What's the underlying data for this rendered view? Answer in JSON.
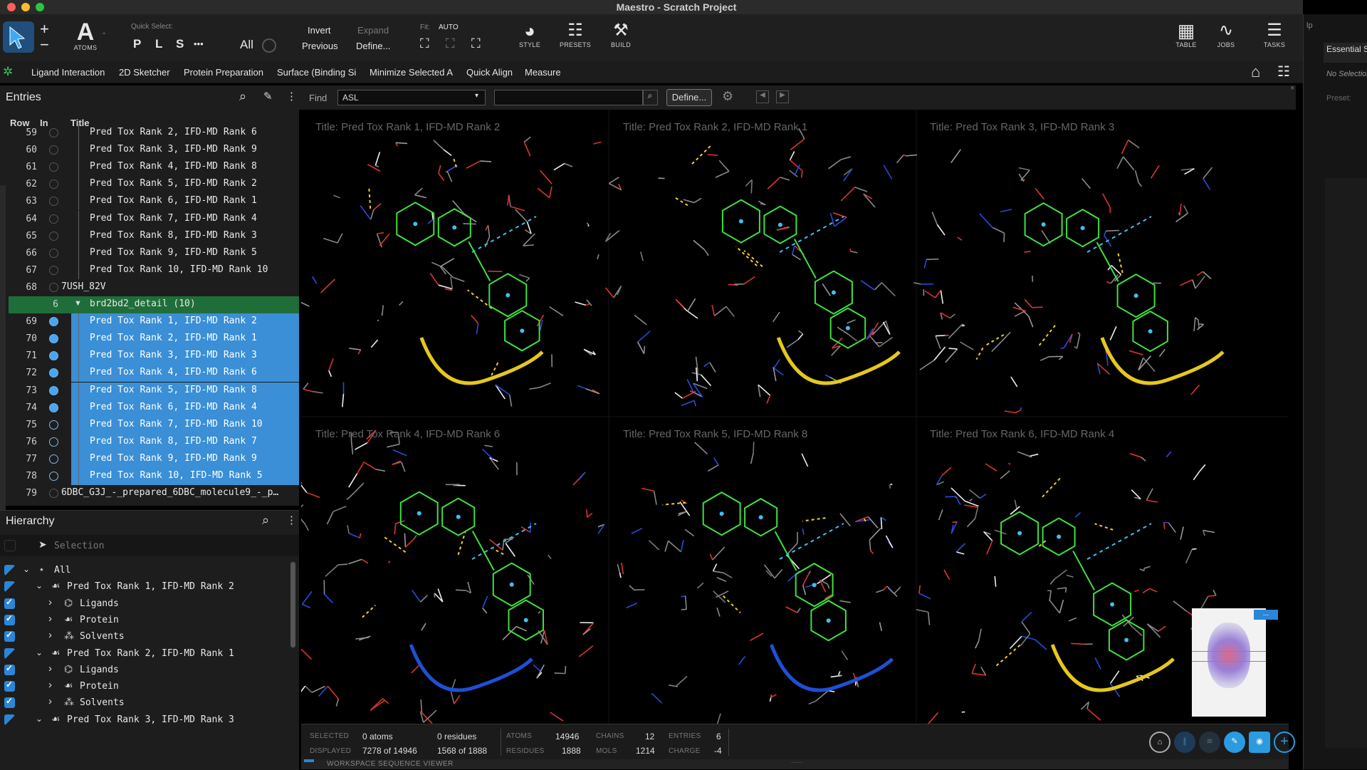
{
  "window": {
    "title": "Maestro - Scratch Project"
  },
  "toolbar": {
    "atoms_label": "ATOMS",
    "quick_select_label": "Quick Select:",
    "qs_p": "P",
    "qs_l": "L",
    "qs_s": "S",
    "qs_more": "•••",
    "qs_all": "All",
    "invert_label": "Invert",
    "previous_label": "Previous",
    "expand_label": "Expand",
    "define_label": "Define...",
    "fit_label": "Fit:",
    "fit_value": "AUTO",
    "style_label": "STYLE",
    "presets_label": "PRESETS",
    "build_label": "BUILD",
    "table_label": "TABLE",
    "jobs_label": "JOBS",
    "tasks_label": "TASKS"
  },
  "menu": [
    "Ligand Interaction",
    "2D Sketcher",
    "Protein Preparation",
    "Surface (Binding Si",
    "Minimize Selected A",
    "Quick Align",
    "Measure"
  ],
  "right_panel": {
    "title": "Essential S",
    "no_selection": "No Selection",
    "preset": "Preset:",
    "help_fragment": "lp"
  },
  "entries": {
    "title": "Entries",
    "col_row": "Row",
    "col_in": "In",
    "col_title": "Title",
    "rows": [
      {
        "num": "59",
        "title": "Pred Tox Rank 2, IFD-MD Rank 6",
        "sel": false
      },
      {
        "num": "60",
        "title": "Pred Tox Rank 3, IFD-MD Rank 9",
        "sel": false
      },
      {
        "num": "61",
        "title": "Pred Tox Rank 4, IFD-MD Rank 8",
        "sel": false
      },
      {
        "num": "62",
        "title": "Pred Tox Rank 5, IFD-MD Rank 2",
        "sel": false
      },
      {
        "num": "63",
        "title": "Pred Tox Rank 6, IFD-MD Rank 1",
        "sel": false
      },
      {
        "num": "64",
        "title": "Pred Tox Rank 7, IFD-MD Rank 4",
        "sel": false
      },
      {
        "num": "65",
        "title": "Pred Tox Rank 8, IFD-MD Rank 3",
        "sel": false
      },
      {
        "num": "66",
        "title": "Pred Tox Rank 9, IFD-MD Rank 5",
        "sel": false
      },
      {
        "num": "67",
        "title": "Pred Tox Rank 10, IFD-MD Rank 10",
        "sel": false
      },
      {
        "num": "68",
        "title": "7USH_82V",
        "sel": false,
        "top": true
      },
      {
        "num": "6",
        "title": "brd2bd2_detail (10)",
        "group": true
      },
      {
        "num": "69",
        "title": "Pred Tox Rank 1, IFD-MD Rank 2",
        "sel": true,
        "inc": true
      },
      {
        "num": "70",
        "title": "Pred Tox Rank 2, IFD-MD Rank 1",
        "sel": true,
        "inc": true
      },
      {
        "num": "71",
        "title": "Pred Tox Rank 3, IFD-MD Rank 3",
        "sel": true,
        "inc": true
      },
      {
        "num": "72",
        "title": "Pred Tox Rank 4, IFD-MD Rank 6",
        "sel": true,
        "inc": true
      },
      {
        "num": "73",
        "title": "Pred Tox Rank 5, IFD-MD Rank 8",
        "sel": true,
        "inc": true
      },
      {
        "num": "74",
        "title": "Pred Tox Rank 6, IFD-MD Rank 4",
        "sel": true,
        "inc": true
      },
      {
        "num": "75",
        "title": "Pred Tox Rank 7, IFD-MD Rank 10",
        "sel": true,
        "inc": false
      },
      {
        "num": "76",
        "title": "Pred Tox Rank 8, IFD-MD Rank 7",
        "sel": true,
        "inc": false
      },
      {
        "num": "77",
        "title": "Pred Tox Rank 9, IFD-MD Rank 9",
        "sel": true,
        "inc": false
      },
      {
        "num": "78",
        "title": "Pred Tox Rank 10, IFD-MD Rank 5",
        "sel": true,
        "inc": false
      },
      {
        "num": "79",
        "title": "6DBC_G3J_-_prepared_6DBC_molecule9_-_p…",
        "sel": false,
        "top": true
      }
    ]
  },
  "hierarchy": {
    "title": "Hierarchy",
    "selection_label": "Selection",
    "items": [
      {
        "label": "All",
        "level": 0,
        "icon": "star",
        "chev": "v",
        "cb": "half"
      },
      {
        "label": "Pred Tox Rank 1, IFD-MD Rank 2",
        "level": 1,
        "icon": "protein",
        "chev": "v",
        "cb": "half"
      },
      {
        "label": "Ligands",
        "level": 2,
        "icon": "ligand",
        "chev": ">",
        "cb": "full"
      },
      {
        "label": "Protein",
        "level": 2,
        "icon": "protein",
        "chev": ">",
        "cb": "full"
      },
      {
        "label": "Solvents",
        "level": 2,
        "icon": "solvent",
        "chev": ">",
        "cb": "full"
      },
      {
        "label": "Pred Tox Rank 2, IFD-MD Rank 1",
        "level": 1,
        "icon": "protein",
        "chev": "v",
        "cb": "half"
      },
      {
        "label": "Ligands",
        "level": 2,
        "icon": "ligand",
        "chev": ">",
        "cb": "full"
      },
      {
        "label": "Protein",
        "level": 2,
        "icon": "protein",
        "chev": ">",
        "cb": "full"
      },
      {
        "label": "Solvents",
        "level": 2,
        "icon": "solvent",
        "chev": ">",
        "cb": "full"
      },
      {
        "label": "Pred Tox Rank 3, IFD-MD Rank 3",
        "level": 1,
        "icon": "protein",
        "chev": "v",
        "cb": "half"
      }
    ]
  },
  "find": {
    "label": "Find",
    "mode": "ASL",
    "define_button": "Define..."
  },
  "workspace": {
    "panels": [
      "Title: Pred Tox Rank 1, IFD-MD Rank 2",
      "Title: Pred Tox Rank 2, IFD-MD Rank 1",
      "Title: Pred Tox Rank 3, IFD-MD Rank 3",
      "Title: Pred Tox Rank 4, IFD-MD Rank 6",
      "Title: Pred Tox Rank 5, IFD-MD Rank 8",
      "Title: Pred Tox Rank 6, IFD-MD Rank 4"
    ],
    "overlay_badge": "..."
  },
  "status": {
    "selected_label": "SELECTED",
    "selected_atoms": "0 atoms",
    "selected_residues": "0 residues",
    "displayed_label": "DISPLAYED",
    "displayed_atoms": "7278 of 14946",
    "displayed_residues": "1568 of 1888",
    "atoms_label": "ATOMS",
    "atoms_value": "14946",
    "residues_label": "RESIDUES",
    "residues_value": "1888",
    "chains_label": "CHAINS",
    "chains_value": "12",
    "mols_label": "MOLS",
    "mols_value": "1214",
    "entries_label": "ENTRIES",
    "entries_value": "6",
    "charge_label": "CHARGE",
    "charge_value": "-4"
  },
  "seqviewer": {
    "label": "WORKSPACE SEQUENCE VIEWER"
  }
}
